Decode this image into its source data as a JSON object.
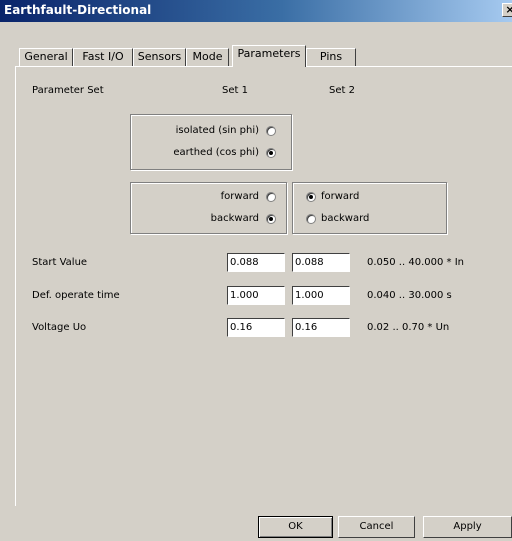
{
  "window": {
    "title": "Earthfault-Directional",
    "close_glyph": "×"
  },
  "tabs": [
    {
      "label": "General"
    },
    {
      "label": "Fast I/O"
    },
    {
      "label": "Sensors"
    },
    {
      "label": "Mode"
    },
    {
      "label": "Parameters",
      "active": true
    },
    {
      "label": "Pins"
    }
  ],
  "params": {
    "param_set_label": "Parameter Set",
    "set1_label": "Set 1",
    "set2_label": "Set 2",
    "grounding": {
      "isolated_label": "isolated (sin phi)",
      "earthed_label": "earthed (cos phi)",
      "selected": "earthed"
    },
    "direction_set1": {
      "forward_label": "forward",
      "backward_label": "backward",
      "selected": "backward"
    },
    "direction_set2": {
      "forward_label": "forward",
      "backward_label": "backward",
      "selected": "forward"
    },
    "rows": [
      {
        "label": "Start Value",
        "set1": "0.088",
        "set2": "0.088",
        "range": "0.050 .. 40.000 * In"
      },
      {
        "label": "Def. operate time",
        "set1": "1.000",
        "set2": "1.000",
        "range": "0.040 .. 30.000 s"
      },
      {
        "label": "Voltage Uo",
        "set1": "0.16",
        "set2": "0.16",
        "range": "0.02 .. 0.70 * Un"
      }
    ]
  },
  "buttons": {
    "ok": "OK",
    "cancel": "Cancel",
    "apply": "Apply"
  }
}
